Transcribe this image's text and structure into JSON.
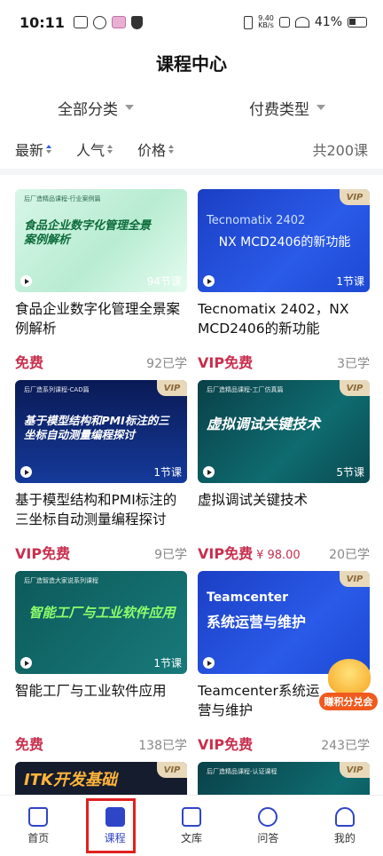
{
  "status": {
    "time": "10:11",
    "net_speed_top": "9.40",
    "net_speed_bottom": "KB/s",
    "battery": "41%"
  },
  "title": "课程中心",
  "filters": {
    "category": "全部分类",
    "fee_type": "付费类型"
  },
  "sort": {
    "newest": "最新",
    "popular": "人气",
    "price": "价格",
    "total": "共200课"
  },
  "courses": [
    {
      "thumb_tag": "后厂造精品课程-行业案例篇",
      "thumb_text": "食品企业数字化管理全景案例解析",
      "lessons": "94节课",
      "title": "食品企业数字化管理全景案例解析",
      "price": "免费",
      "orig_price": "",
      "learned": "92已学",
      "vip": false
    },
    {
      "thumb_tag": "",
      "thumb_text": "NX MCD2406的新功能",
      "thumb_sub": "Tecnomatix 2402",
      "lessons": "1节课",
      "title": "Tecnomatix 2402，NX MCD2406的新功能",
      "price": "VIP免费",
      "orig_price": "",
      "learned": "3已学",
      "vip": true,
      "vip_label": "VIP"
    },
    {
      "thumb_tag": "后厂造系列课程-CAD篇",
      "thumb_text": "基于模型结构和PMI标注的三坐标自动测量编程探讨",
      "lessons": "1节课",
      "title": "基于模型结构和PMI标注的三坐标自动测量编程探讨",
      "price": "VIP免费",
      "orig_price": "",
      "learned": "9已学",
      "vip": true,
      "vip_label": "VIP"
    },
    {
      "thumb_tag": "后厂造精品课程-工厂仿真篇",
      "thumb_text": "虚拟调试关键技术",
      "lessons": "5节课",
      "title": "虚拟调试关键技术",
      "price": "VIP免费",
      "orig_price": "¥ 98.00",
      "learned": "20已学",
      "vip": true,
      "vip_label": "VIP"
    },
    {
      "thumb_tag": "后厂造智造大家说系列课程",
      "thumb_text": "智能工厂与工业软件应用",
      "lessons": "1节课",
      "title": "智能工厂与工业软件应用",
      "price": "免费",
      "orig_price": "",
      "learned": "138已学",
      "vip": false
    },
    {
      "thumb_tag": "",
      "thumb_text": "系统运营与维护",
      "thumb_sub": "Teamcenter",
      "lessons": "",
      "title": "Teamcenter系统运营与维护",
      "price": "VIP免费",
      "orig_price": "",
      "learned": "243已学",
      "vip": true,
      "vip_label": "VIP"
    },
    {
      "thumb_tag": "",
      "thumb_text": "ITK开发基础",
      "lessons": "",
      "title": "",
      "price": "",
      "orig_price": "",
      "learned": "",
      "vip": true,
      "vip_label": "VIP"
    },
    {
      "thumb_tag": "后厂造精品课程-认证课程",
      "thumb_text": "",
      "lessons": "",
      "title": "",
      "price": "",
      "orig_price": "",
      "learned": "",
      "vip": true,
      "vip_label": "VIP"
    }
  ],
  "promo": {
    "label": "赚积分兑会"
  },
  "nav": [
    {
      "label": "首页",
      "icon": "home-icon"
    },
    {
      "label": "课程",
      "icon": "course-icon"
    },
    {
      "label": "文库",
      "icon": "library-icon"
    },
    {
      "label": "问答",
      "icon": "qa-icon"
    },
    {
      "label": "我的",
      "icon": "profile-icon"
    }
  ],
  "colors": {
    "accent": "#2f45c8",
    "price": "#c82f4e",
    "highlight": "#e02020"
  }
}
